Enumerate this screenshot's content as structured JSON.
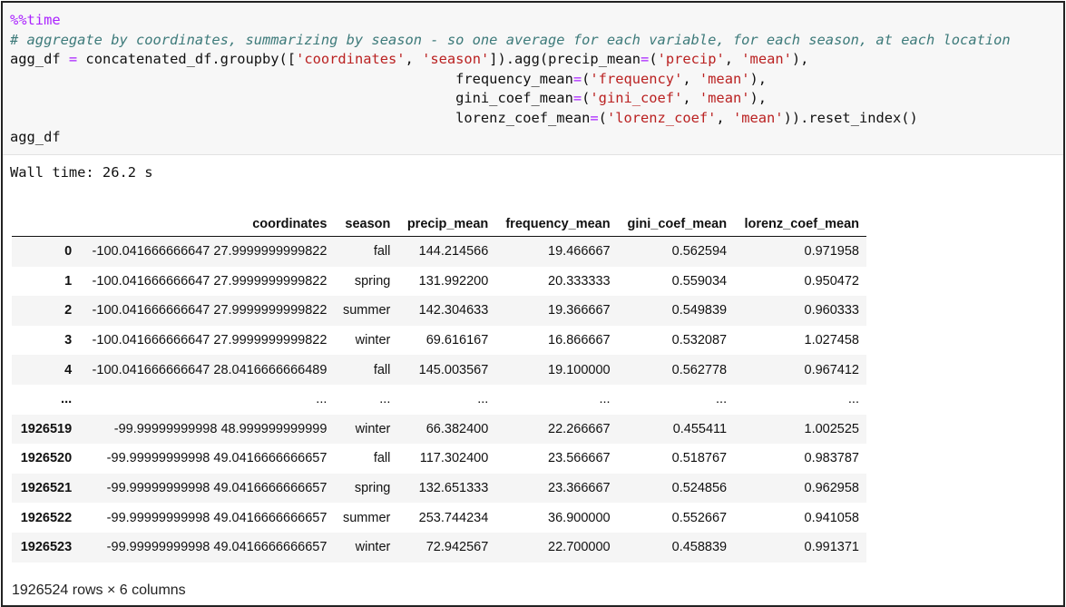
{
  "code_cell": {
    "magic": "%%time",
    "comment": "# aggregate by coordinates, summarizing by season - so one average for each variable, for each season, at each location",
    "line_agg": {
      "lhs": "agg_df ",
      "eq": "=",
      "mid": " concatenated_df.groupby([",
      "s1": "'coordinates'",
      "comma": ", ",
      "s2": "'season'",
      "after": "]).agg(precip_mean",
      "eq2": "=",
      "open": "(",
      "s3": "'precip'",
      "s4": "'mean'",
      "close": "),"
    },
    "line_freq": {
      "name": "frequency_mean",
      "s1": "'frequency'",
      "s2": "'mean'",
      "close": "),"
    },
    "line_gini": {
      "name": "gini_coef_mean",
      "s1": "'gini_coef'",
      "s2": "'mean'",
      "close": "),"
    },
    "line_lorenz": {
      "name": "lorenz_coef_mean",
      "s1": "'lorenz_coef'",
      "s2": "'mean'",
      "close": ")).reset_index()"
    },
    "last_line": "agg_df"
  },
  "output": {
    "wall_time": "Wall time: 26.2 s",
    "table": {
      "columns": [
        "",
        "coordinates",
        "season",
        "precip_mean",
        "frequency_mean",
        "gini_coef_mean",
        "lorenz_coef_mean"
      ],
      "rows": [
        [
          "0",
          "-100.041666666647 27.9999999999822",
          "fall",
          "144.214566",
          "19.466667",
          "0.562594",
          "0.971958"
        ],
        [
          "1",
          "-100.041666666647 27.9999999999822",
          "spring",
          "131.992200",
          "20.333333",
          "0.559034",
          "0.950472"
        ],
        [
          "2",
          "-100.041666666647 27.9999999999822",
          "summer",
          "142.304633",
          "19.366667",
          "0.549839",
          "0.960333"
        ],
        [
          "3",
          "-100.041666666647 27.9999999999822",
          "winter",
          "69.616167",
          "16.866667",
          "0.532087",
          "1.027458"
        ],
        [
          "4",
          "-100.041666666647 28.0416666666489",
          "fall",
          "145.003567",
          "19.100000",
          "0.562778",
          "0.967412"
        ],
        [
          "...",
          "...",
          "...",
          "...",
          "...",
          "...",
          "..."
        ],
        [
          "1926519",
          "-99.99999999998 48.999999999999",
          "winter",
          "66.382400",
          "22.266667",
          "0.455411",
          "1.002525"
        ],
        [
          "1926520",
          "-99.99999999998 49.0416666666657",
          "fall",
          "117.302400",
          "23.566667",
          "0.518767",
          "0.983787"
        ],
        [
          "1926521",
          "-99.99999999998 49.0416666666657",
          "spring",
          "132.651333",
          "23.366667",
          "0.524856",
          "0.962958"
        ],
        [
          "1926522",
          "-99.99999999998 49.0416666666657",
          "summer",
          "253.744234",
          "36.900000",
          "0.552667",
          "0.941058"
        ],
        [
          "1926523",
          "-99.99999999998 49.0416666666657",
          "winter",
          "72.942567",
          "22.700000",
          "0.458839",
          "0.991371"
        ]
      ]
    },
    "shape_note": "1926524 rows × 6 columns"
  },
  "colors": {
    "code_bg": "#f7f7f7",
    "magic": "#aa22ff",
    "comment": "#3d7a7a",
    "string": "#ba2121",
    "zebra": "#f5f5f5"
  }
}
